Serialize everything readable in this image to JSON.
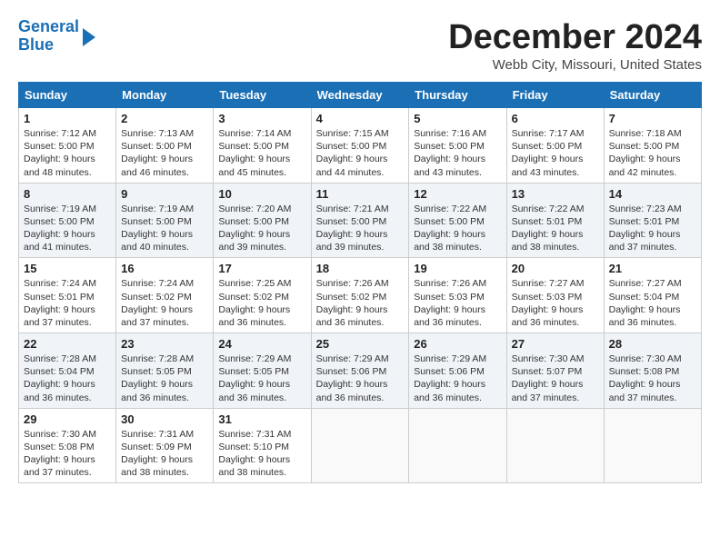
{
  "logo": {
    "line1": "General",
    "line2": "Blue"
  },
  "title": "December 2024",
  "location": "Webb City, Missouri, United States",
  "header_days": [
    "Sunday",
    "Monday",
    "Tuesday",
    "Wednesday",
    "Thursday",
    "Friday",
    "Saturday"
  ],
  "weeks": [
    [
      {
        "day": "1",
        "info": "Sunrise: 7:12 AM\nSunset: 5:00 PM\nDaylight: 9 hours\nand 48 minutes."
      },
      {
        "day": "2",
        "info": "Sunrise: 7:13 AM\nSunset: 5:00 PM\nDaylight: 9 hours\nand 46 minutes."
      },
      {
        "day": "3",
        "info": "Sunrise: 7:14 AM\nSunset: 5:00 PM\nDaylight: 9 hours\nand 45 minutes."
      },
      {
        "day": "4",
        "info": "Sunrise: 7:15 AM\nSunset: 5:00 PM\nDaylight: 9 hours\nand 44 minutes."
      },
      {
        "day": "5",
        "info": "Sunrise: 7:16 AM\nSunset: 5:00 PM\nDaylight: 9 hours\nand 43 minutes."
      },
      {
        "day": "6",
        "info": "Sunrise: 7:17 AM\nSunset: 5:00 PM\nDaylight: 9 hours\nand 43 minutes."
      },
      {
        "day": "7",
        "info": "Sunrise: 7:18 AM\nSunset: 5:00 PM\nDaylight: 9 hours\nand 42 minutes."
      }
    ],
    [
      {
        "day": "8",
        "info": "Sunrise: 7:19 AM\nSunset: 5:00 PM\nDaylight: 9 hours\nand 41 minutes."
      },
      {
        "day": "9",
        "info": "Sunrise: 7:19 AM\nSunset: 5:00 PM\nDaylight: 9 hours\nand 40 minutes."
      },
      {
        "day": "10",
        "info": "Sunrise: 7:20 AM\nSunset: 5:00 PM\nDaylight: 9 hours\nand 39 minutes."
      },
      {
        "day": "11",
        "info": "Sunrise: 7:21 AM\nSunset: 5:00 PM\nDaylight: 9 hours\nand 39 minutes."
      },
      {
        "day": "12",
        "info": "Sunrise: 7:22 AM\nSunset: 5:00 PM\nDaylight: 9 hours\nand 38 minutes."
      },
      {
        "day": "13",
        "info": "Sunrise: 7:22 AM\nSunset: 5:01 PM\nDaylight: 9 hours\nand 38 minutes."
      },
      {
        "day": "14",
        "info": "Sunrise: 7:23 AM\nSunset: 5:01 PM\nDaylight: 9 hours\nand 37 minutes."
      }
    ],
    [
      {
        "day": "15",
        "info": "Sunrise: 7:24 AM\nSunset: 5:01 PM\nDaylight: 9 hours\nand 37 minutes."
      },
      {
        "day": "16",
        "info": "Sunrise: 7:24 AM\nSunset: 5:02 PM\nDaylight: 9 hours\nand 37 minutes."
      },
      {
        "day": "17",
        "info": "Sunrise: 7:25 AM\nSunset: 5:02 PM\nDaylight: 9 hours\nand 36 minutes."
      },
      {
        "day": "18",
        "info": "Sunrise: 7:26 AM\nSunset: 5:02 PM\nDaylight: 9 hours\nand 36 minutes."
      },
      {
        "day": "19",
        "info": "Sunrise: 7:26 AM\nSunset: 5:03 PM\nDaylight: 9 hours\nand 36 minutes."
      },
      {
        "day": "20",
        "info": "Sunrise: 7:27 AM\nSunset: 5:03 PM\nDaylight: 9 hours\nand 36 minutes."
      },
      {
        "day": "21",
        "info": "Sunrise: 7:27 AM\nSunset: 5:04 PM\nDaylight: 9 hours\nand 36 minutes."
      }
    ],
    [
      {
        "day": "22",
        "info": "Sunrise: 7:28 AM\nSunset: 5:04 PM\nDaylight: 9 hours\nand 36 minutes."
      },
      {
        "day": "23",
        "info": "Sunrise: 7:28 AM\nSunset: 5:05 PM\nDaylight: 9 hours\nand 36 minutes."
      },
      {
        "day": "24",
        "info": "Sunrise: 7:29 AM\nSunset: 5:05 PM\nDaylight: 9 hours\nand 36 minutes."
      },
      {
        "day": "25",
        "info": "Sunrise: 7:29 AM\nSunset: 5:06 PM\nDaylight: 9 hours\nand 36 minutes."
      },
      {
        "day": "26",
        "info": "Sunrise: 7:29 AM\nSunset: 5:06 PM\nDaylight: 9 hours\nand 36 minutes."
      },
      {
        "day": "27",
        "info": "Sunrise: 7:30 AM\nSunset: 5:07 PM\nDaylight: 9 hours\nand 37 minutes."
      },
      {
        "day": "28",
        "info": "Sunrise: 7:30 AM\nSunset: 5:08 PM\nDaylight: 9 hours\nand 37 minutes."
      }
    ],
    [
      {
        "day": "29",
        "info": "Sunrise: 7:30 AM\nSunset: 5:08 PM\nDaylight: 9 hours\nand 37 minutes."
      },
      {
        "day": "30",
        "info": "Sunrise: 7:31 AM\nSunset: 5:09 PM\nDaylight: 9 hours\nand 38 minutes."
      },
      {
        "day": "31",
        "info": "Sunrise: 7:31 AM\nSunset: 5:10 PM\nDaylight: 9 hours\nand 38 minutes."
      },
      {
        "day": "",
        "info": ""
      },
      {
        "day": "",
        "info": ""
      },
      {
        "day": "",
        "info": ""
      },
      {
        "day": "",
        "info": ""
      }
    ]
  ]
}
